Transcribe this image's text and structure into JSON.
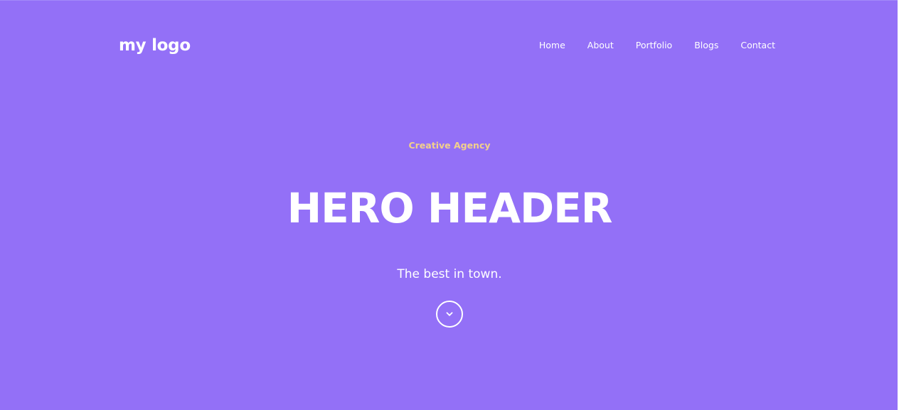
{
  "header": {
    "logo_text": "my logo",
    "nav": [
      {
        "label": "Home"
      },
      {
        "label": "About"
      },
      {
        "label": "Portfolio"
      },
      {
        "label": "Blogs"
      },
      {
        "label": "Contact"
      }
    ]
  },
  "hero": {
    "tagline": "Creative Agency",
    "title": "HERO HEADER",
    "subtitle": "The best in town.",
    "scroll_icon": "chevron-down-icon"
  },
  "colors": {
    "background": "#9370F7",
    "accent": "#F2D08B",
    "text": "#FFFFFF"
  }
}
